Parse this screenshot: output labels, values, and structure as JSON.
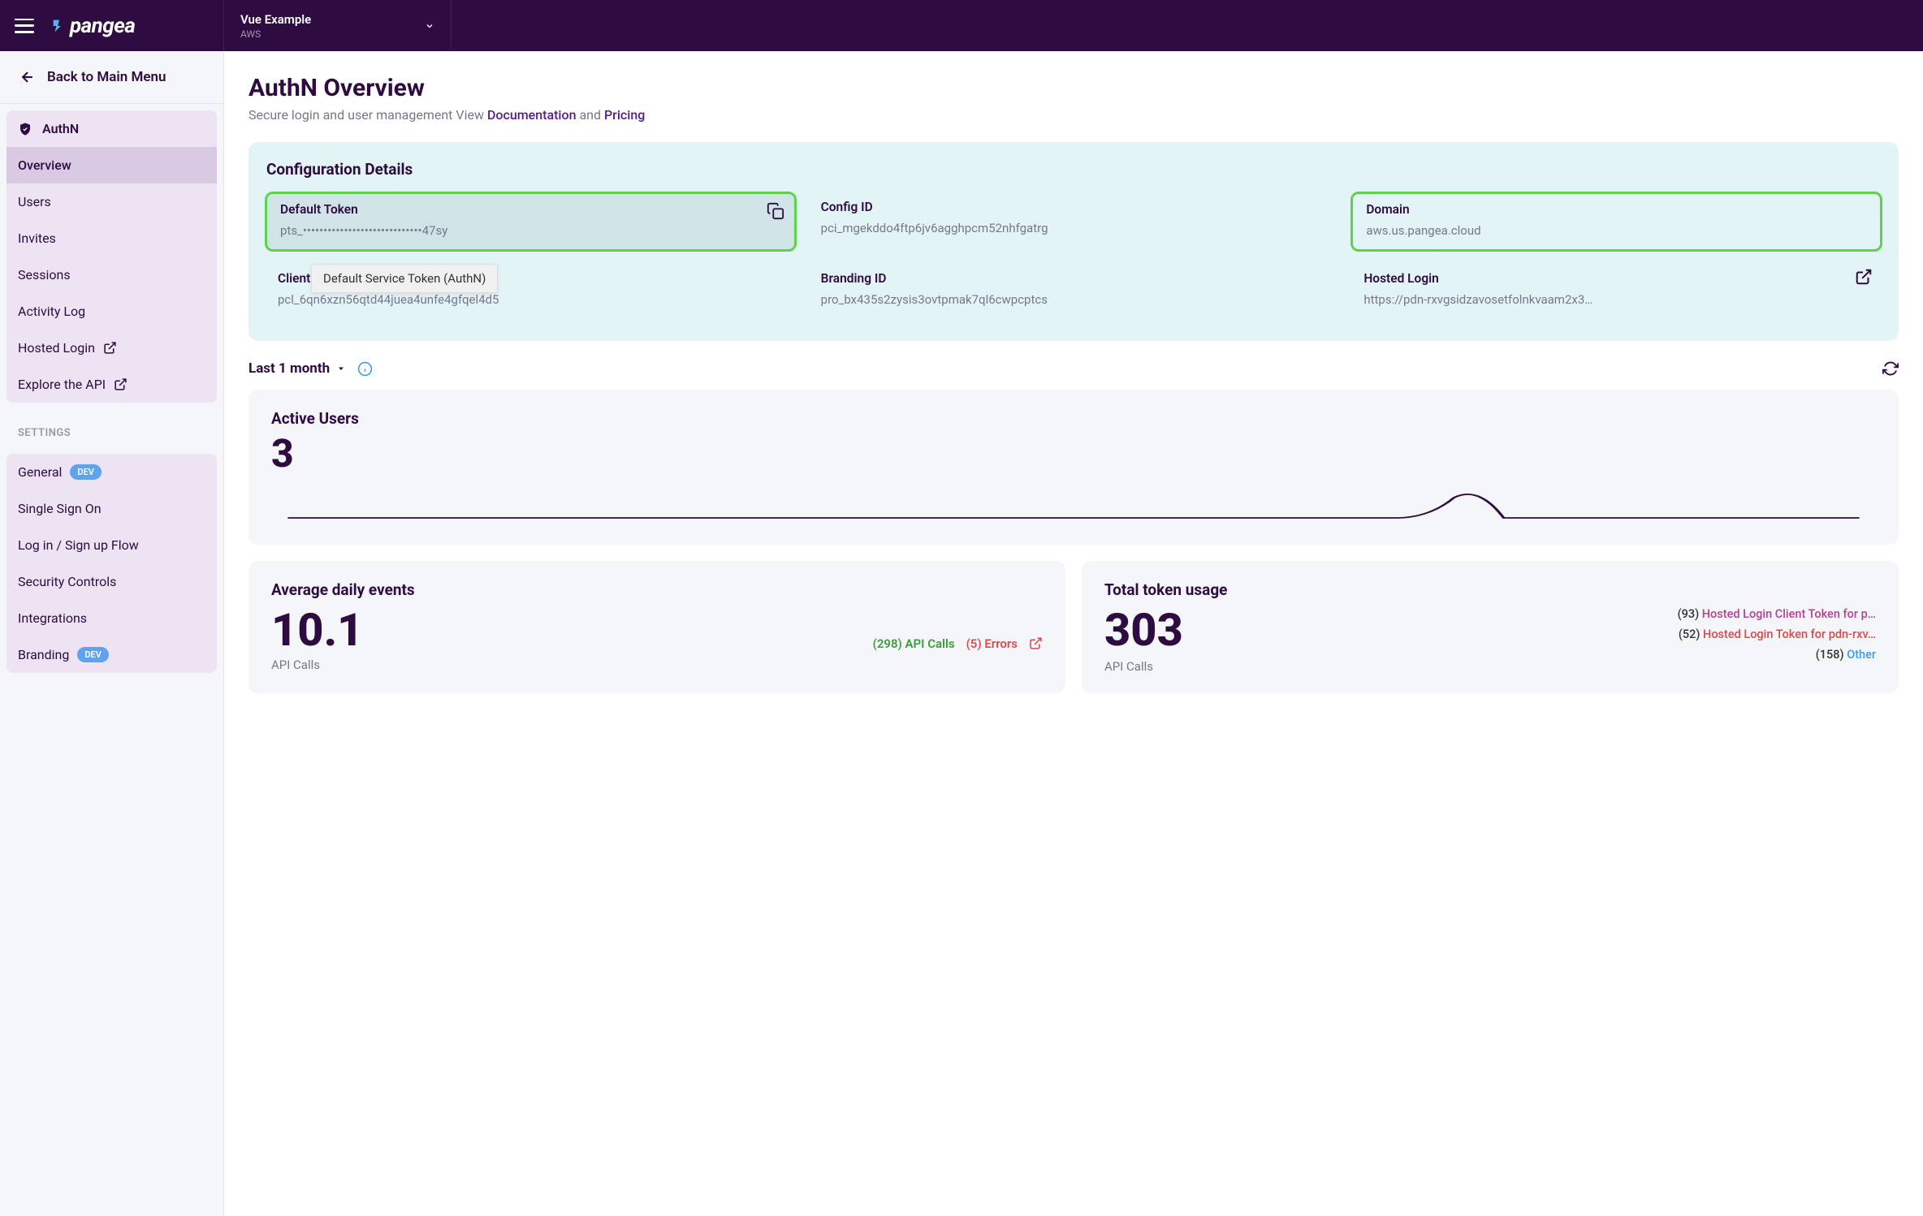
{
  "header": {
    "project_name": "Vue Example",
    "project_sub": "AWS"
  },
  "sidebar": {
    "back_label": "Back to Main Menu",
    "parent": "AuthN",
    "items": [
      {
        "label": "Overview"
      },
      {
        "label": "Users"
      },
      {
        "label": "Invites"
      },
      {
        "label": "Sessions"
      },
      {
        "label": "Activity Log"
      },
      {
        "label": "Hosted Login"
      },
      {
        "label": "Explore the API"
      }
    ],
    "settings_label": "SETTINGS",
    "settings": [
      {
        "label": "General",
        "dev": "DEV"
      },
      {
        "label": "Single Sign On"
      },
      {
        "label": "Log in / Sign up Flow"
      },
      {
        "label": "Security Controls"
      },
      {
        "label": "Integrations"
      },
      {
        "label": "Branding",
        "dev": "DEV"
      }
    ]
  },
  "page": {
    "title": "AuthN Overview",
    "subtitle_prefix": "Secure login and user management View ",
    "doc_label": "Documentation",
    "and": " and ",
    "pricing_label": "Pricing"
  },
  "config": {
    "title": "Configuration Details",
    "tooltip": "Default Service Token (AuthN)",
    "cells": [
      {
        "label": "Default Token",
        "value": "pts_•••••••••••••••••••••••••••••47sy"
      },
      {
        "label": "Config ID",
        "value": "pci_mgekddo4ftp6jv6agghpcm52nhfgatrg"
      },
      {
        "label": "Domain",
        "value": "aws.us.pangea.cloud"
      },
      {
        "label": "Client Token",
        "value": "pcl_6qn6xzn56qtd44juea4unfe4gfqel4d5"
      },
      {
        "label": "Branding ID",
        "value": "pro_bx435s2zysis3ovtpmak7ql6cwpcptcs"
      },
      {
        "label": "Hosted Login",
        "value": "https://pdn-rxvgsidzavosetfolnkvaam2x3…"
      }
    ]
  },
  "period": {
    "label": "Last 1 month"
  },
  "active_users": {
    "title": "Active Users",
    "value": "3"
  },
  "avg_events": {
    "title": "Average daily events",
    "value": "10.1",
    "sub": "API Calls",
    "api_calls": "(298) API Calls",
    "errors": "(5) Errors"
  },
  "token_usage": {
    "title": "Total token usage",
    "value": "303",
    "sub": "API Calls",
    "rows": [
      {
        "count": "(93)",
        "label": "Hosted Login Client Token for p…",
        "color": "#b84097"
      },
      {
        "count": "(52)",
        "label": "Hosted Login Token for pdn-rxv…",
        "color": "#d94a4a"
      },
      {
        "count": "(158)",
        "label": "Other",
        "color": "#3b9de5"
      }
    ]
  },
  "chart_data": {
    "type": "line",
    "title": "Active Users sparkline",
    "x_range": [
      0,
      30
    ],
    "ylim": [
      0,
      3
    ],
    "series": [
      {
        "name": "Active Users",
        "values": [
          0,
          0,
          0,
          0,
          0,
          0,
          0,
          0,
          0,
          0,
          0,
          0,
          0,
          0,
          0,
          0,
          0,
          0,
          0,
          0,
          0,
          1,
          3,
          1,
          0,
          0,
          0,
          0,
          0,
          0
        ]
      }
    ]
  }
}
